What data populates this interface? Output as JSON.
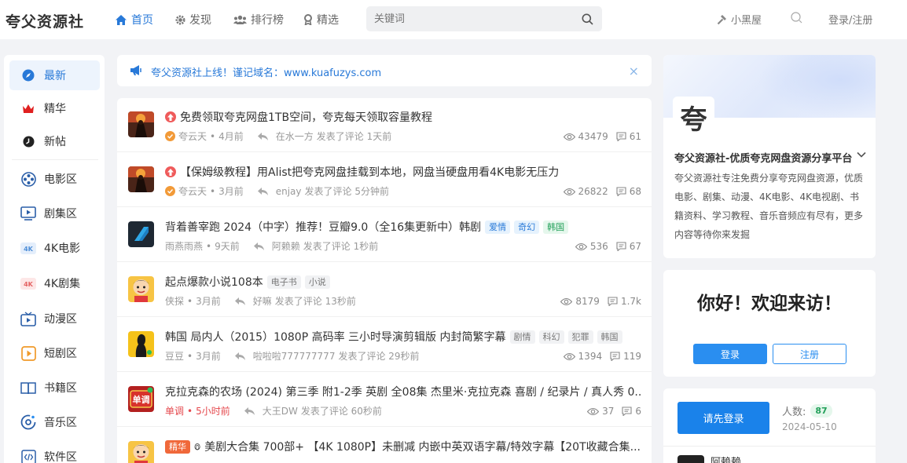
{
  "header": {
    "logo": "夸父资源社",
    "nav": [
      {
        "label": "首页",
        "icon": "home-icon",
        "active": true
      },
      {
        "label": "发现",
        "icon": "gear-icon",
        "active": false
      },
      {
        "label": "排行榜",
        "icon": "users-icon",
        "active": false
      },
      {
        "label": "精选",
        "icon": "award-icon",
        "active": false
      }
    ],
    "search_placeholder": "关键词",
    "blackroom": "小黑屋",
    "login": "登录/注册"
  },
  "sidebar": {
    "items": [
      {
        "label": "最新",
        "icon": "compass-icon",
        "active": true
      },
      {
        "label": "精华",
        "icon": "crown-icon"
      },
      {
        "label": "新帖",
        "icon": "clock-icon"
      },
      {
        "label": "电影区",
        "icon": "film-reel-icon"
      },
      {
        "label": "剧集区",
        "icon": "play-screen-icon"
      },
      {
        "label": "4K电影",
        "icon": "4k-icon"
      },
      {
        "label": "4K剧集",
        "icon": "4k-red-icon"
      },
      {
        "label": "动漫区",
        "icon": "tv-icon"
      },
      {
        "label": "短剧区",
        "icon": "play-square-icon"
      },
      {
        "label": "书籍区",
        "icon": "book-icon"
      },
      {
        "label": "音乐区",
        "icon": "music-disc-icon"
      },
      {
        "label": "软件区",
        "icon": "code-icon"
      }
    ]
  },
  "notice": {
    "text": "夸父资源社上线！谨记域名：www.kuafuzys.com",
    "close": "×"
  },
  "posts": [
    {
      "title": "免费领取夸克网盘1TB空间，夸克每天领取容量教程",
      "hot": true,
      "tags": [],
      "author": "夸云天",
      "verified": true,
      "time": "4月前",
      "replier": "在水一方",
      "reply_text": "发表了评论 1天前",
      "views": "43479",
      "comments": "61",
      "thumb": "fire"
    },
    {
      "title": "【保姆级教程】用Alist把夸克网盘挂载到本地，网盘当硬盘用看4K电影无压力",
      "hot": true,
      "tags": [],
      "author": "夸云天",
      "verified": true,
      "time": "3月前",
      "replier": "enjay",
      "reply_text": "发表了评论 5分钟前",
      "views": "26822",
      "comments": "68",
      "thumb": "fire"
    },
    {
      "title": "背着善宰跑 2024（中字）推荐！豆瓣9.0（全16集更新中）韩剧",
      "hot": false,
      "tags": [
        {
          "t": "爱情",
          "c": "blue"
        },
        {
          "t": "奇幻",
          "c": "blue"
        },
        {
          "t": "韩国",
          "c": "green"
        }
      ],
      "author": "雨燕雨燕",
      "time": "9天前",
      "replier": "阿赖赖",
      "reply_text": "发表了评论 1秒前",
      "views": "536",
      "comments": "67",
      "thumb": "dark"
    },
    {
      "title": "起点爆款小说108本",
      "hot": false,
      "tags": [
        {
          "t": "电子书",
          "c": ""
        },
        {
          "t": "小说",
          "c": ""
        }
      ],
      "author": "侠探",
      "time": "3月前",
      "replier": "好嘛",
      "reply_text": "发表了评论 13秒前",
      "views": "8179",
      "comments": "1.7k",
      "thumb": "cartoon"
    },
    {
      "title": "韩国 局内人（2015）1080P 高码率 三小时导演剪辑版 内封简繁字幕",
      "hot": false,
      "tags": [
        {
          "t": "剧情",
          "c": ""
        },
        {
          "t": "科幻",
          "c": ""
        },
        {
          "t": "犯罪",
          "c": ""
        },
        {
          "t": "韩国",
          "c": ""
        }
      ],
      "author": "豆豆",
      "time": "3月前",
      "replier": "啦啦啦777777777",
      "reply_text": "发表了评论 29秒前",
      "views": "1394",
      "comments": "119",
      "thumb": "yellow"
    },
    {
      "title": "克拉克森的农场 (2024) 第三季 附1-2季 英剧 全08集 杰里米·克拉克森 喜剧 / 纪录片 / 真人秀 0...",
      "hot": false,
      "tags": [],
      "author": "单调",
      "author_red": true,
      "time": "5小时前",
      "time_red": true,
      "replier": "大王DW",
      "reply_text": "发表了评论 60秒前",
      "views": "37",
      "comments": "6",
      "thumb": "red"
    },
    {
      "title": "美剧大合集 700部+ 【4K 1080P】未删减 内嵌中英双语字幕/特效字幕【20T收藏合集...",
      "hot": false,
      "featured": "精华",
      "tags": [],
      "author": "",
      "time": "",
      "replier": "",
      "reply_text": "",
      "views": "",
      "comments": "",
      "thumb": "cartoon"
    }
  ],
  "site_card": {
    "avatar_char": "夸",
    "name": "夸父资源社-优质夸克网盘资源分享平台",
    "desc": "夸父资源社专注免费分享夸克网盘资源，优质电影、剧集、动漫、4K电影、4K电视剧、书籍资料、学习教程、音乐音频应有尽有，更多内容等待你来发掘"
  },
  "welcome": {
    "title": "你好！欢迎来访！",
    "login": "登录",
    "register": "注册"
  },
  "online": {
    "button": "请先登录",
    "count_label": "人数:",
    "count": "87",
    "date": "2024-05-10",
    "user": "阿赖赖"
  }
}
